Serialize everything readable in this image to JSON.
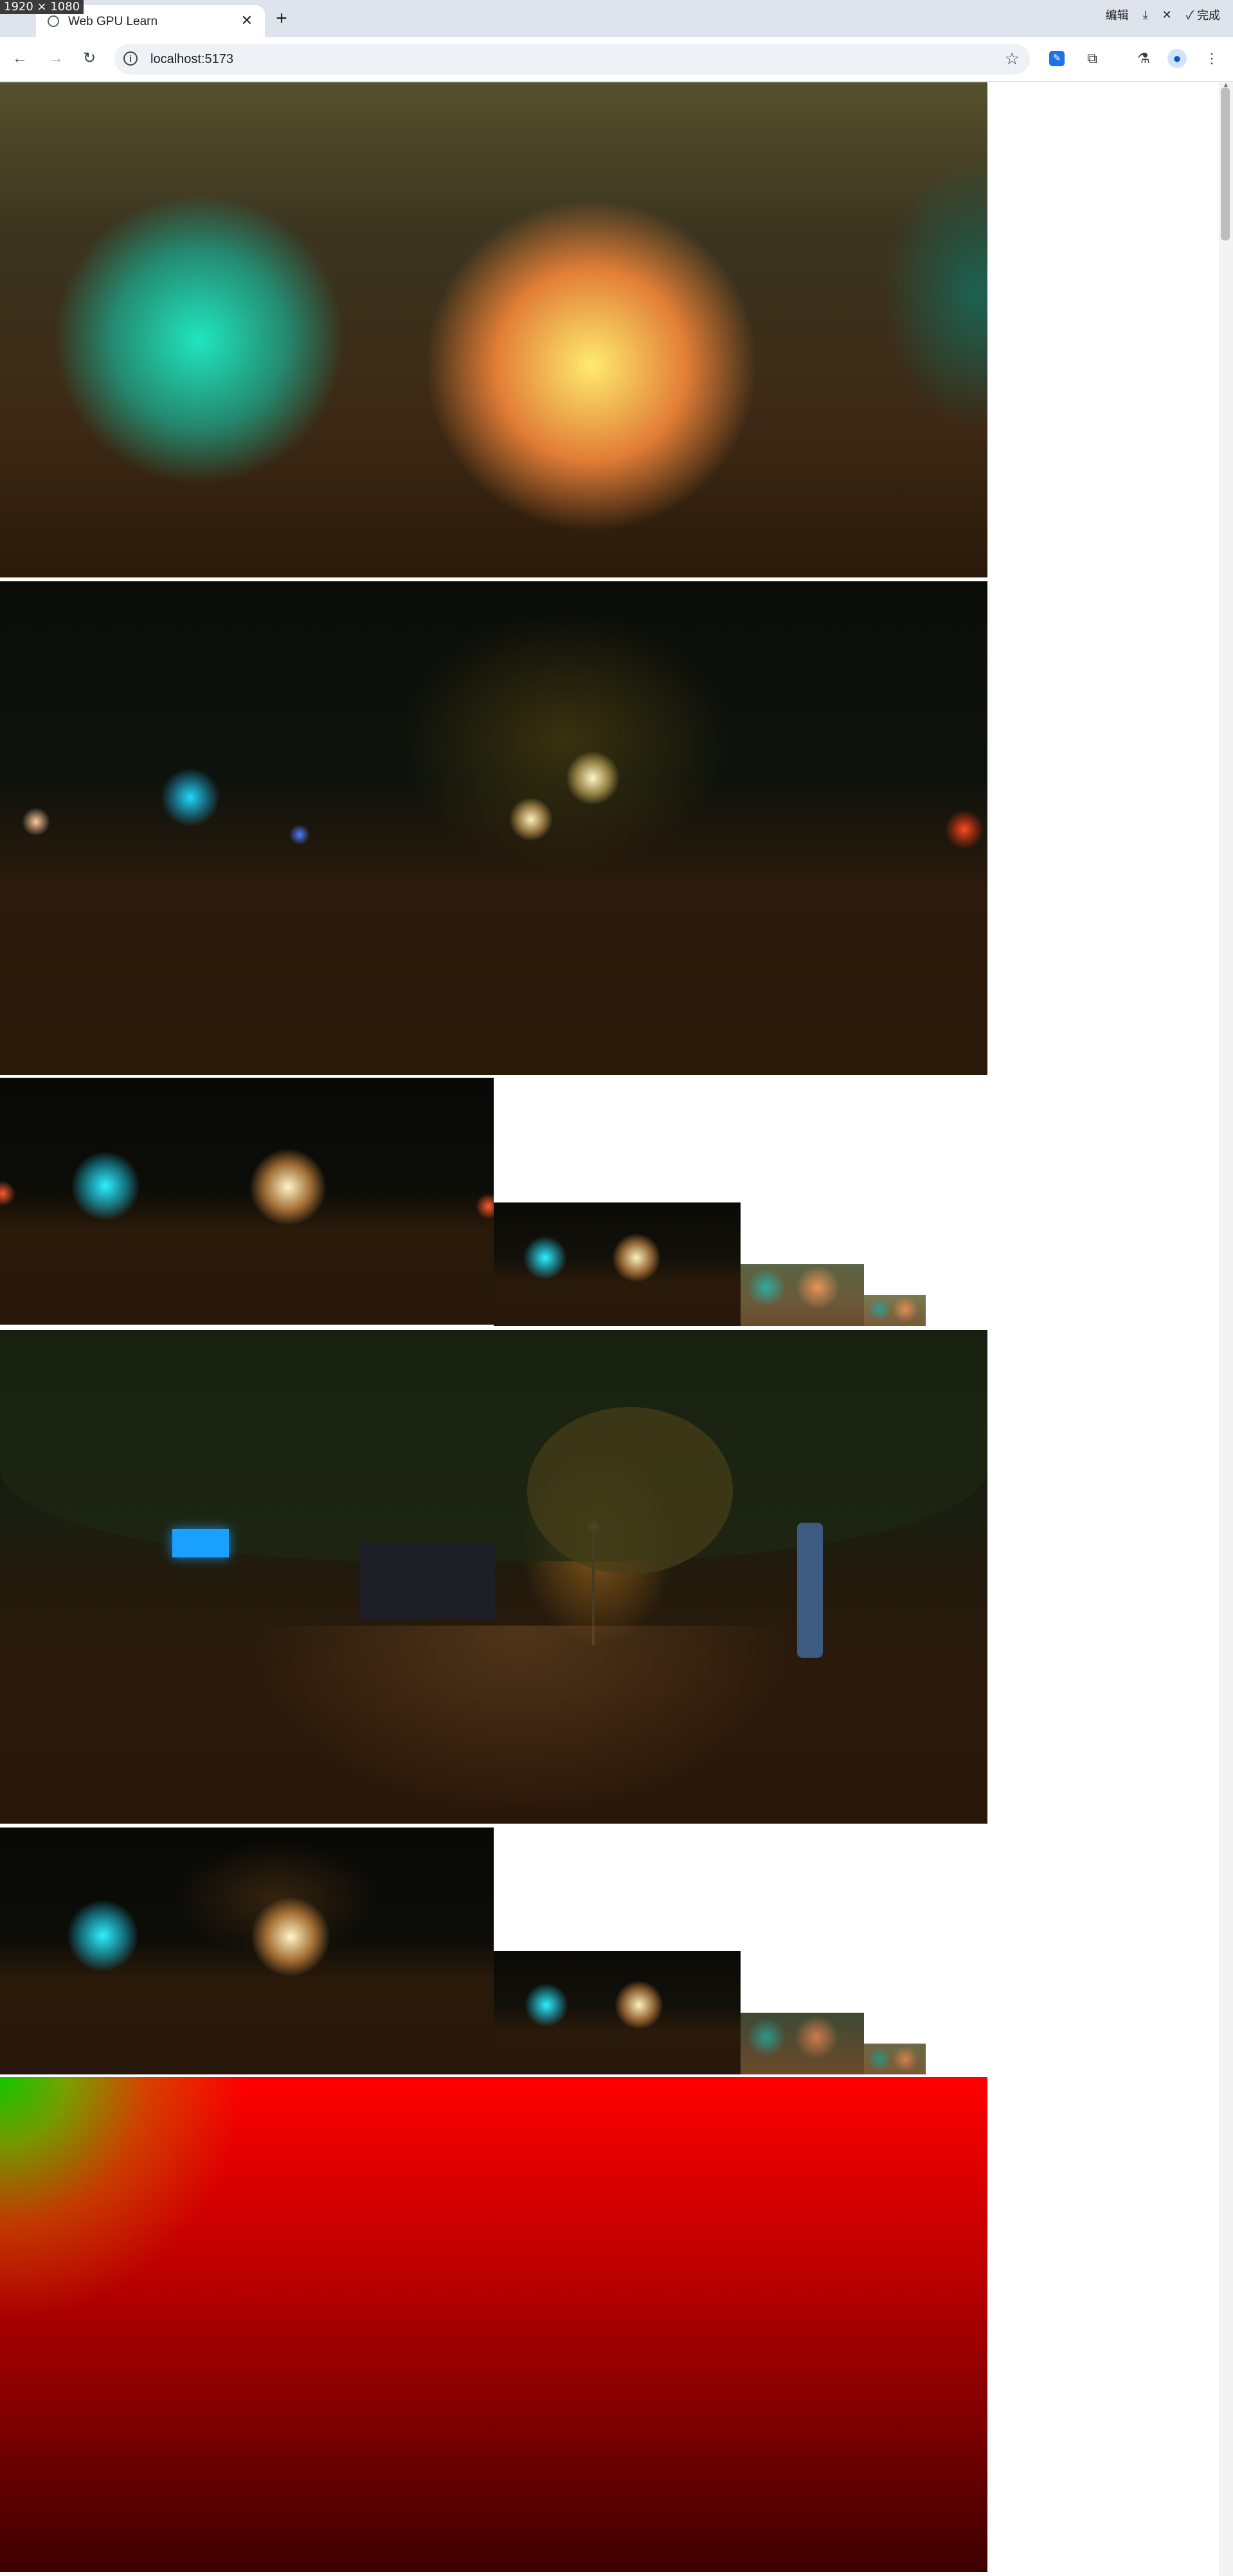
{
  "screenshot_badge": "1920 × 1080",
  "tab": {
    "title": "Web GPU Learn",
    "close_glyph": "✕"
  },
  "new_tab_glyph": "+",
  "edit_tools": {
    "edit_label": "编辑",
    "done_label": "完成"
  },
  "address_bar": {
    "url": "localhost:5173"
  },
  "canvases": [
    {
      "name": "irradiance-map"
    },
    {
      "name": "prefiltered-environment"
    },
    {
      "name": "mip-chain-a",
      "levels": 4
    },
    {
      "name": "hdr-environment"
    },
    {
      "name": "mip-chain-b",
      "levels": 4
    },
    {
      "name": "brdf-lut"
    }
  ],
  "icons": {
    "back": "←",
    "forward": "→",
    "reload": "↻",
    "star": "☆",
    "extension": "✎",
    "puzzle": "⧉",
    "labs": "⚗",
    "profile": "●",
    "menu": "⋮",
    "download": "⤓",
    "close": "✕",
    "check": "✓"
  }
}
